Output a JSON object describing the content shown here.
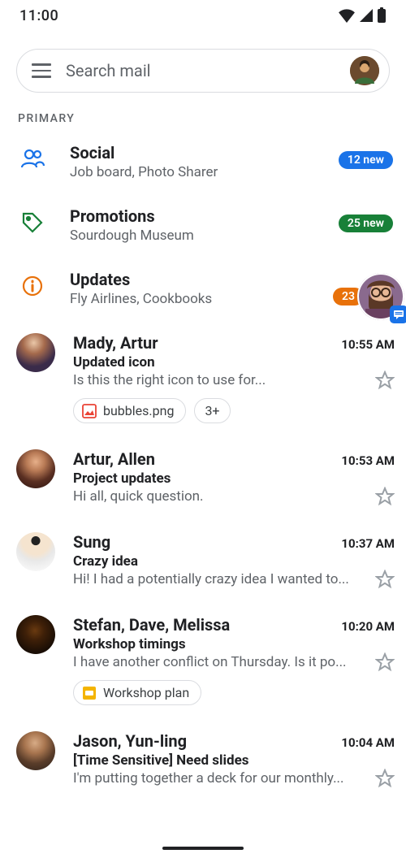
{
  "status": {
    "time": "11:00"
  },
  "search": {
    "placeholder": "Search mail"
  },
  "section_label": "PRIMARY",
  "categories": [
    {
      "name": "Social",
      "sub": "Job board, Photo Sharer",
      "badge": "12 new",
      "badge_color": "blue",
      "icon": "people"
    },
    {
      "name": "Promotions",
      "sub": "Sourdough Museum",
      "badge": "25 new",
      "badge_color": "green",
      "icon": "tag"
    },
    {
      "name": "Updates",
      "sub": "Fly Airlines, Cookbooks",
      "badge": "23",
      "badge_color": "orange",
      "icon": "info"
    }
  ],
  "messages": [
    {
      "sender": "Mady, Artur",
      "time": "10:55 AM",
      "subject": "Updated icon",
      "preview": "Is this the right icon to use for...",
      "attachments": [
        {
          "type": "image",
          "name": "bubbles.png"
        }
      ],
      "more_count": "3+",
      "avatar_bg": "radial-gradient(circle at 45% 25%, #eac7a8 0%, #a56a4c 30%, #3a2b4a 65%)"
    },
    {
      "sender": "Artur, Allen",
      "time": "10:53 AM",
      "subject": "Project updates",
      "preview": "Hi all, quick question.",
      "avatar_bg": "radial-gradient(circle at 50% 32%, #e7b08a 0%, #b87a55 28%, #5a2f22 60%, #2a1410 100%)"
    },
    {
      "sender": "Sung",
      "time": "10:37 AM",
      "subject": "Crazy idea",
      "preview": "Hi! I had a potentially crazy idea I wanted to...",
      "avatar_bg": "radial-gradient(circle at 50% 22%, #222 0%, #222 12%, #f5e4cf 13%, #f5e4cf 38%, #e8e8e8 55%, #fff 100%)"
    },
    {
      "sender": "Stefan, Dave, Melissa",
      "time": "10:20 AM",
      "subject": "Workshop timings",
      "preview": "I have another conflict on Thursday. Is it po...",
      "attachments": [
        {
          "type": "slides",
          "name": "Workshop plan"
        }
      ],
      "avatar_bg": "radial-gradient(circle at 48% 40%, #6a3a10 0%, #3f2008 30%, #1a0e05 70%)"
    },
    {
      "sender": "Jason, Yun-ling",
      "time": "10:04 AM",
      "subject": "[Time Sensitive] Need slides",
      "preview": "I'm putting together a deck for our monthly...",
      "avatar_bg": "radial-gradient(circle at 48% 30%, #d7ab86 0%, #a8754f 30%, #5a3d2a 60%, #2c221c 100%)"
    }
  ]
}
